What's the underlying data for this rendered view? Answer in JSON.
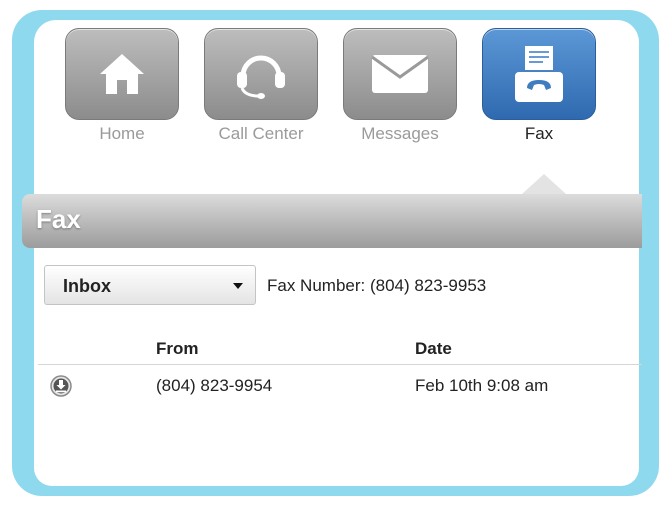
{
  "tabs": [
    {
      "label": "Home",
      "icon": "home-icon",
      "active": false
    },
    {
      "label": "Call Center",
      "icon": "headset-icon",
      "active": false
    },
    {
      "label": "Messages",
      "icon": "envelope-icon",
      "active": false
    },
    {
      "label": "Fax",
      "icon": "fax-icon",
      "active": true
    }
  ],
  "panel": {
    "title": "Fax",
    "folder_select": "Inbox",
    "fax_number": "Fax Number: (804) 823-9953"
  },
  "table": {
    "columns": [
      "From",
      "Date"
    ],
    "rows": [
      {
        "from": "(804) 823-9954",
        "date": "Feb 10th 9:08 am",
        "action_icon": "download-icon"
      }
    ]
  },
  "colors": {
    "frame": "#8fd9ee",
    "active_tab": "#3f7cc2",
    "inactive_tab": "#a8a8a8"
  }
}
